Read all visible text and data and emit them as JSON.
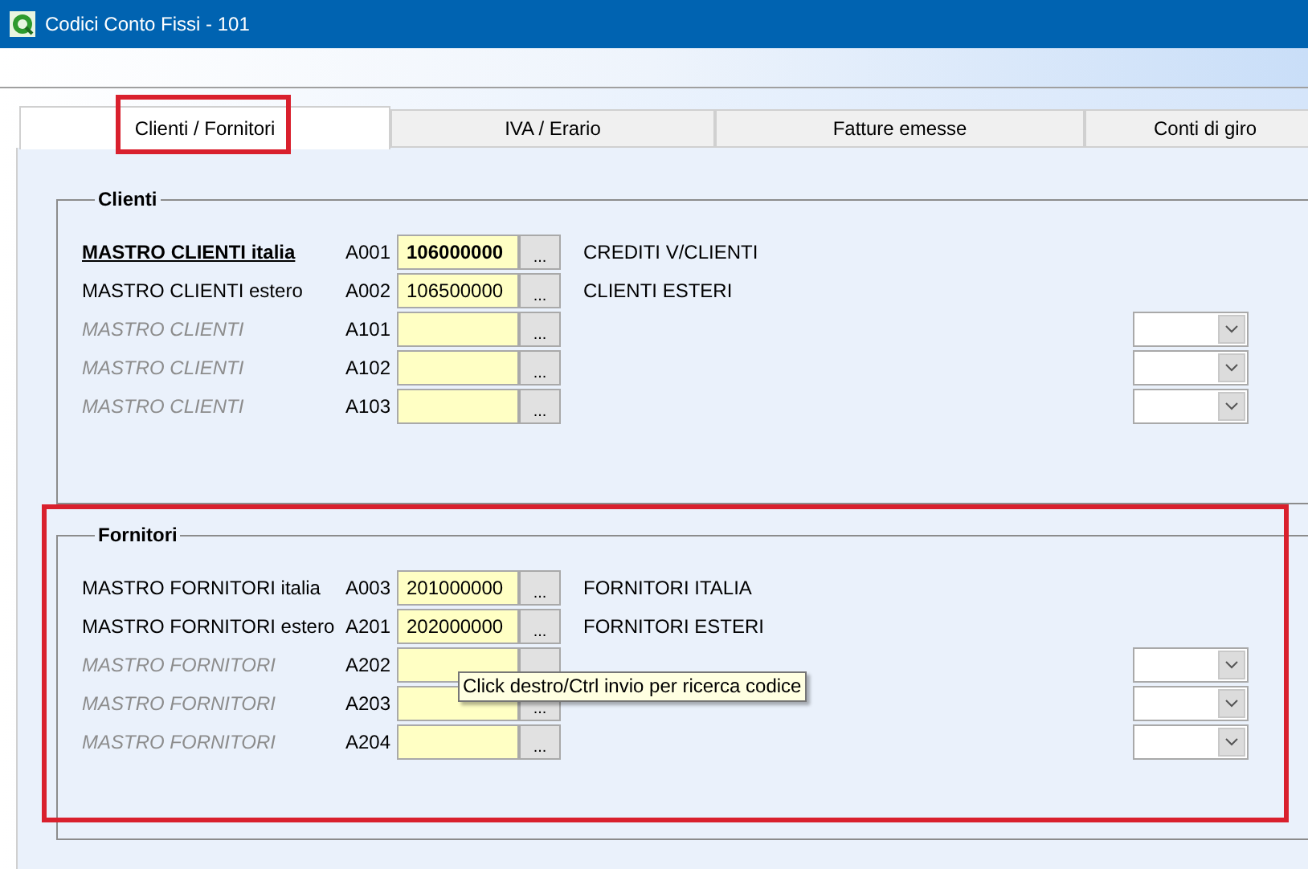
{
  "window": {
    "title": "Codici Conto Fissi - 101"
  },
  "tabs": [
    {
      "label": "Clienti / Fornitori",
      "selected": true,
      "highlighted": true
    },
    {
      "label": "IVA / Erario",
      "selected": false,
      "highlighted": false
    },
    {
      "label": "Fatture emesse",
      "selected": false,
      "highlighted": false
    },
    {
      "label": "Conti di giro",
      "selected": false,
      "highlighted": false
    }
  ],
  "groups": [
    {
      "title": "Clienti",
      "highlighted": false,
      "rows": [
        {
          "label": "MASTRO CLIENTI italia",
          "kind": "primary",
          "code": "A001",
          "value": "106000000",
          "description": "CREDITI V/CLIENTI",
          "button": "..."
        },
        {
          "label": "MASTRO CLIENTI estero",
          "kind": "normal",
          "code": "A002",
          "value": "106500000",
          "description": "CLIENTI ESTERI",
          "button": "..."
        },
        {
          "label": "MASTRO CLIENTI",
          "kind": "inactive",
          "code": "A101",
          "button": "..."
        },
        {
          "label": "MASTRO CLIENTI",
          "kind": "inactive",
          "code": "A102",
          "button": "..."
        },
        {
          "label": "MASTRO CLIENTI",
          "kind": "inactive",
          "code": "A103",
          "button": "..."
        }
      ]
    },
    {
      "title": "Fornitori",
      "highlighted": true,
      "rows": [
        {
          "label": "MASTRO FORNITORI italia",
          "kind": "normal",
          "code": "A003",
          "value": "201000000",
          "description": "FORNITORI ITALIA",
          "button": "..."
        },
        {
          "label": "MASTRO FORNITORI estero",
          "kind": "normal",
          "code": "A201",
          "value": "202000000",
          "description": "FORNITORI ESTERI",
          "button": "..."
        },
        {
          "label": "MASTRO FORNITORI",
          "kind": "inactive",
          "code": "A202"
        },
        {
          "label": "MASTRO FORNITORI",
          "kind": "inactive",
          "code": "A203",
          "button": "..."
        },
        {
          "label": "MASTRO FORNITORI",
          "kind": "inactive",
          "code": "A204",
          "button": "..."
        }
      ]
    }
  ],
  "tooltip": {
    "text": "Click destro/Ctrl invio per ricerca codice"
  }
}
